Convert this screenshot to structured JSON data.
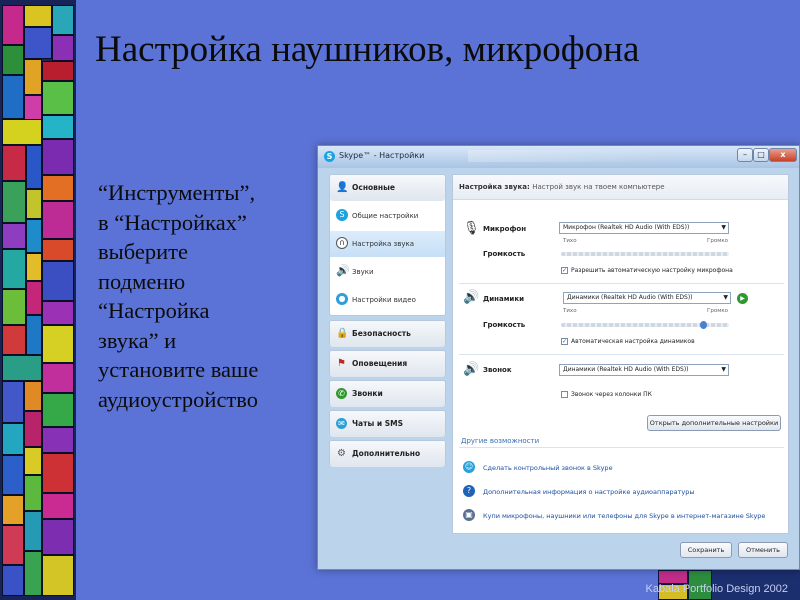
{
  "slide": {
    "title": "Настройка наушников, микрофона",
    "instructions": [
      "“Инструменты”,",
      "в “Настройках”",
      "выберите",
      "подменю",
      "“Настройка",
      "звука” и",
      "установите ваше",
      "аудиоустройство"
    ],
    "credit": "Kabala Portfolio Design 2002"
  },
  "window": {
    "title": "Skype™ - Настройки",
    "controls": {
      "minimize": "–",
      "maximize": "□",
      "close": "x"
    }
  },
  "nav": {
    "groups": [
      {
        "label": "Основные",
        "icon": "person-icon",
        "items": [
          {
            "label": "Общие настройки",
            "icon": "skype-icon",
            "selected": false
          },
          {
            "label": "Настройка звука",
            "icon": "headset-icon",
            "selected": true
          },
          {
            "label": "Звуки",
            "icon": "speaker-icon",
            "selected": false
          },
          {
            "label": "Настройки видео",
            "icon": "webcam-icon",
            "selected": false
          }
        ]
      },
      {
        "label": "Безопасность",
        "icon": "padlock-icon"
      },
      {
        "label": "Оповещения",
        "icon": "flag-icon"
      },
      {
        "label": "Звонки",
        "icon": "phone-icon"
      },
      {
        "label": "Чаты и SMS",
        "icon": "chat-icon"
      },
      {
        "label": "Дополнительно",
        "icon": "gear-icon"
      }
    ]
  },
  "content": {
    "header_title": "Настройка звука:",
    "header_subtitle": "Настрой звук на твоем компьютере",
    "microphone": {
      "label": "Микрофон",
      "device": "Микрофон (Realtek HD Audio (With EDS))",
      "volume_label": "Громкость",
      "quiet": "Тихо",
      "loud": "Громко",
      "auto_label": "Разрешить автоматическую настройку микрофона",
      "auto_checked": true
    },
    "speakers": {
      "label": "Динамики",
      "device": "Динамики (Realtek HD Audio (With EDS))",
      "volume_label": "Громкость",
      "quiet": "Тихо",
      "loud": "Громко",
      "volume_level": 0.85,
      "auto_label": "Автоматическая настройка динамиков",
      "auto_checked": true
    },
    "ringer": {
      "label": "Звонок",
      "device": "Динамики (Realtek HD Audio (With EDS))",
      "pc_speaker_label": "Звонок через колонки ПК",
      "pc_speaker_checked": false
    },
    "advanced_button": "Открыть дополнительные настройки",
    "other_section": "Другие возможности",
    "links": [
      "Сделать контрольный звонок в Skype",
      "Дополнительная информация о настройке аудиоаппаратуры",
      "Купи микрофоны, наушники или телефоны для Skype в интернет-магазине Skype"
    ],
    "save_button": "Сохранить",
    "cancel_button": "Отменить"
  }
}
